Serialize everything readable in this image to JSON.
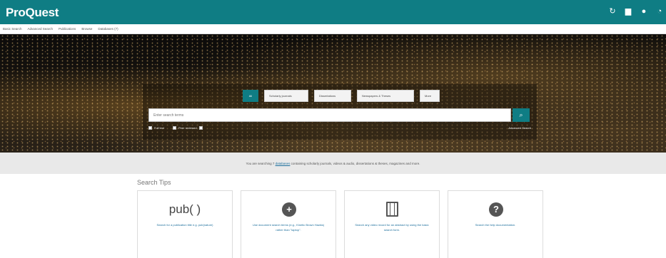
{
  "app": {
    "logo": "ProQuest"
  },
  "topbar_icons": [
    "history-icon",
    "folder-icon",
    "user-icon",
    "help-icon"
  ],
  "subnav": [
    "Basic Search",
    "Advanced Search",
    "Publications",
    "Browse",
    "Databases (7)"
  ],
  "search": {
    "tabs": [
      "All",
      "Scholarly journals",
      "Dissertations",
      "Newspapers & Theses",
      "More"
    ],
    "placeholder": "Enter search terms",
    "options": {
      "full_text": "Full text",
      "peer_reviewed": "Peer reviewed"
    },
    "advanced": "Advanced Search"
  },
  "info": {
    "prefix": "You are searching 7 ",
    "link": "databases",
    "suffix": " containing scholarly journals, videos & audio, dissertations & theses, magazines and more."
  },
  "tips": {
    "title": "Search Tips",
    "cards": [
      {
        "symbol": "pub( )",
        "text": "Search for a publication title e.g. pub(nature)"
      },
      {
        "icon": "plus-circle-icon",
        "symbol": "+",
        "text": "Use document search terms (e.g., Kinetic Brown Hawks) rather than \"laptop\"."
      },
      {
        "icon": "film-icon",
        "text": "Search any video record for an abstract by using the basic search form."
      },
      {
        "icon": "question-icon",
        "symbol": "?",
        "text": "Search the help documentation."
      }
    ]
  },
  "colors": {
    "brand": "#0f7d84",
    "link": "#1d6f9c"
  }
}
